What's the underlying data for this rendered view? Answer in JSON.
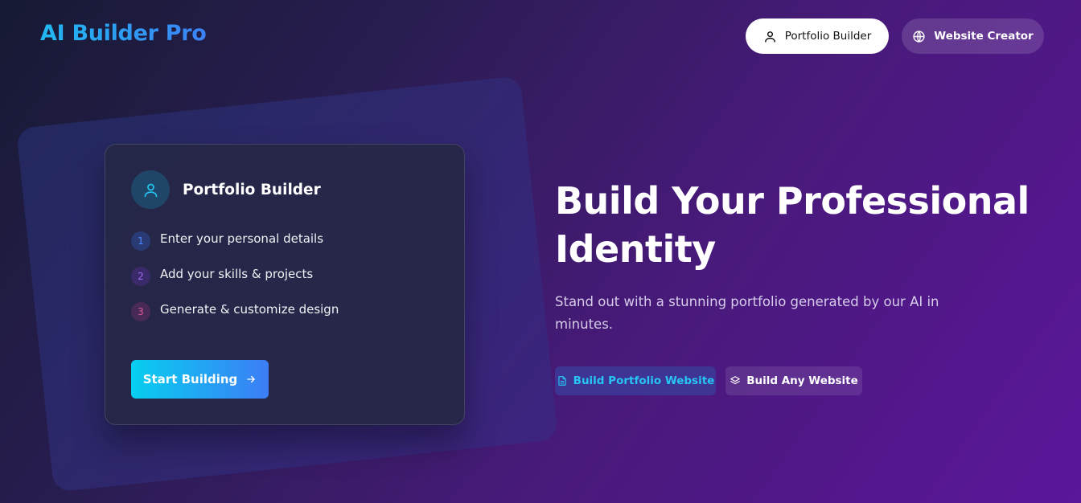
{
  "header": {
    "logo": "AI Builder Pro",
    "nav": [
      {
        "label": "Portfolio Builder",
        "icon": "user-icon"
      },
      {
        "label": "Website Creator",
        "icon": "globe-icon"
      }
    ]
  },
  "card": {
    "icon": "user-icon",
    "title": "Portfolio Builder",
    "steps": [
      {
        "num": "1",
        "text": "Enter your personal details"
      },
      {
        "num": "2",
        "text": "Add your skills & projects"
      },
      {
        "num": "3",
        "text": "Generate & customize design"
      }
    ],
    "button": {
      "label": "Start Building",
      "icon": "arrow-right-icon"
    }
  },
  "hero": {
    "title": "Build Your Professional Identity",
    "subtitle": "Stand out with a stunning portfolio generated by our AI in minutes.",
    "buttons": [
      {
        "label": "Build Portfolio Website",
        "icon": "file-icon"
      },
      {
        "label": "Build Any Website",
        "icon": "layers-icon"
      }
    ]
  },
  "colors": {
    "accent_cyan": "#06cff0",
    "accent_blue": "#3d7df6",
    "background_dark": "#161a33",
    "background_purple": "#5b169a"
  }
}
